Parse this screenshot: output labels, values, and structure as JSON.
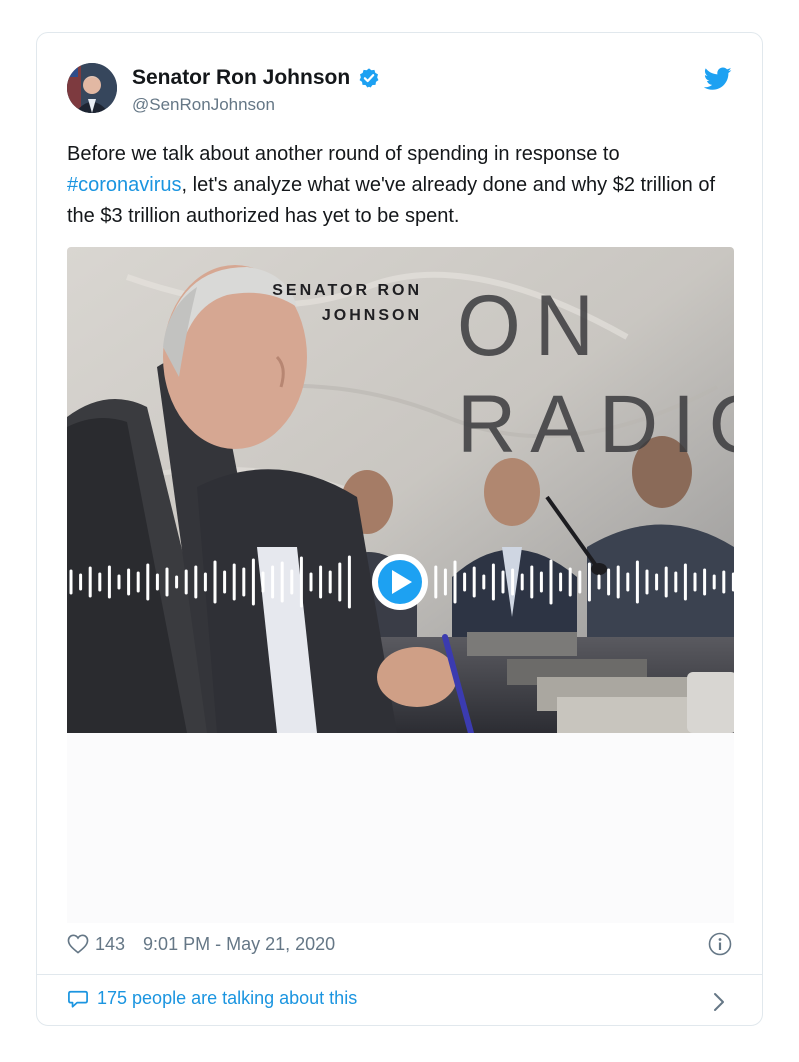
{
  "author": {
    "name": "Senator Ron Johnson",
    "handle": "@SenRonJohnson"
  },
  "tweet": {
    "text_before": "Before we talk about another round of spending in response to ",
    "hashtag": "#coronavirus",
    "text_after": ", let's analyze what we've already done and why $2 trillion of the $3 trillion authorized has yet to be spent."
  },
  "media": {
    "kicker_line1": "SENATOR RON",
    "kicker_line2": "JOHNSON",
    "title_line1": "ON",
    "title_line2": "RADIO"
  },
  "meta": {
    "like_count": "143",
    "timestamp": "9:01 PM - May 21, 2020"
  },
  "footer": {
    "conversation": "175 people are talking about this"
  },
  "colors": {
    "link": "#1b95e0",
    "text": "#14171a",
    "secondary": "#657786",
    "border": "#e1e8ed"
  },
  "icons": [
    "verified-badge-icon",
    "twitter-bird-icon",
    "heart-icon",
    "info-icon",
    "speech-bubble-icon",
    "chevron-right-icon",
    "play-icon"
  ]
}
